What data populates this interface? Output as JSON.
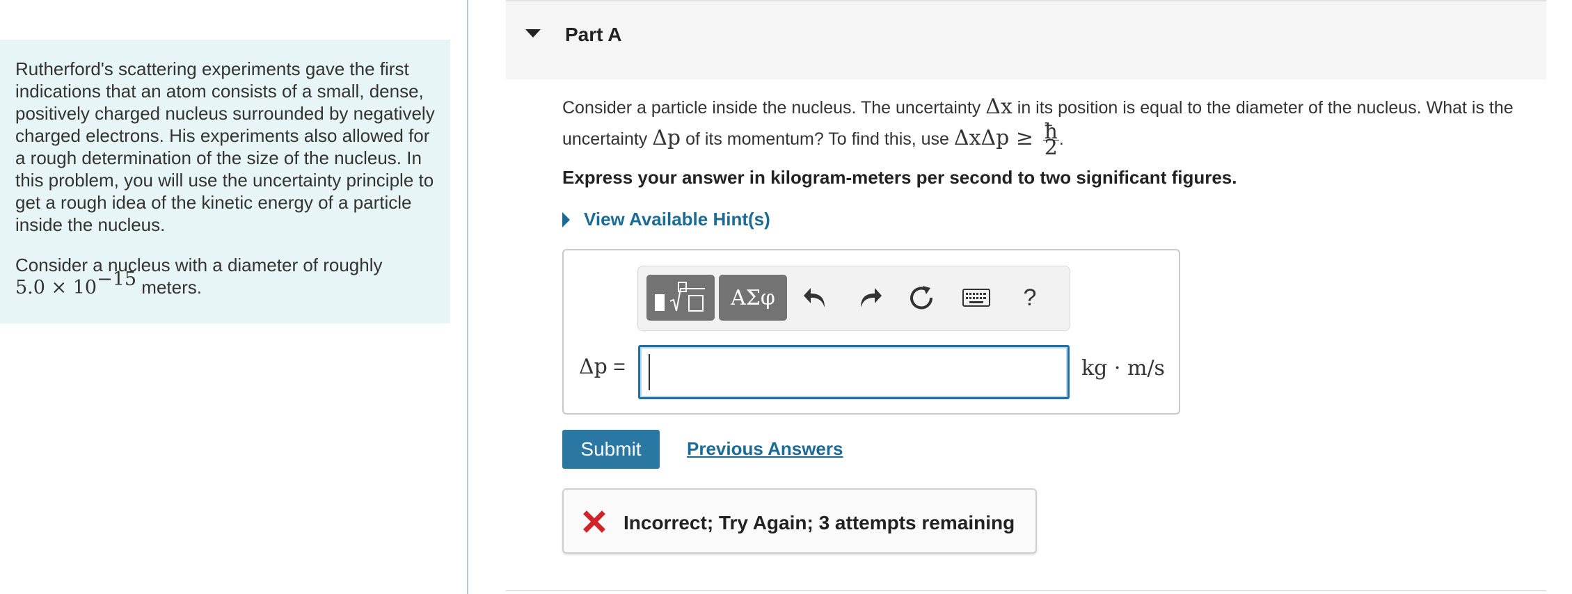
{
  "intro": {
    "paragraph1": "Rutherford's scattering experiments gave the first indications that an atom consists of a small, dense, positively charged nucleus surrounded by negatively charged electrons. His experiments also allowed for a rough determination of the size of the nucleus. In this problem, you will use the uncertainty principle to get a rough idea of the kinetic energy of a particle inside the nucleus.",
    "paragraph2_prefix": "Consider a nucleus with a diameter of roughly",
    "diameter_mantissa": "5.0 × 10",
    "diameter_exponent": "−15",
    "diameter_units": " meters."
  },
  "part": {
    "title": "Part A"
  },
  "question": {
    "text1": "Consider a particle inside the nucleus. The uncertainty ",
    "math_dx": "Δx",
    "text2": " in its position is equal to the diameter of the nucleus. What is the uncertainty ",
    "math_dp": "Δp",
    "text3": " of its momentum? To find this, use ",
    "math_ineq": "ΔxΔp ≥ ",
    "frac_num": "ħ",
    "frac_den": "2",
    "text4": "."
  },
  "instruction": "Express your answer in kilogram-meters per second to two significant figures.",
  "hint_label": "View Available Hint(s)",
  "toolbar": {
    "symbols_label": "ΑΣφ",
    "help_label": "?"
  },
  "answer": {
    "variable": "Δp",
    "equals": " =",
    "value": "",
    "units": "kg · m/s"
  },
  "submit_label": "Submit",
  "previous_answers_label": "Previous Answers",
  "feedback": {
    "message": "Incorrect; Try Again; 3 attempts remaining"
  },
  "colors": {
    "accent": "#1c6b96",
    "button": "#2a77a3",
    "error": "#d0242b",
    "intro_bg": "#e8f5f6"
  }
}
